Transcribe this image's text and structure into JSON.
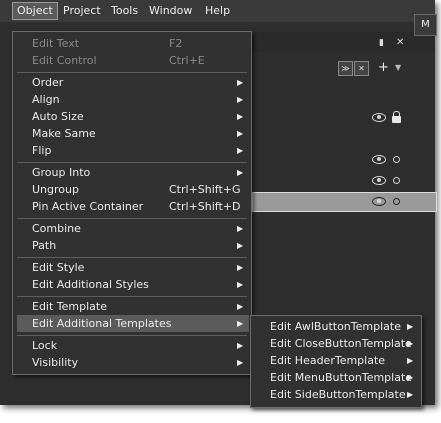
{
  "menubar": {
    "items": [
      {
        "label": "Object",
        "active": true
      },
      {
        "label": "Project"
      },
      {
        "label": "Tools"
      },
      {
        "label": "Window"
      },
      {
        "label": "Help"
      }
    ]
  },
  "object_menu": {
    "items": [
      {
        "label": "Edit Text",
        "shortcut": "F2",
        "disabled": true
      },
      {
        "label": "Edit Control",
        "shortcut": "Ctrl+E",
        "disabled": true
      },
      {
        "label": "Order"
      },
      {
        "label": "Align"
      },
      {
        "label": "Auto Size"
      },
      {
        "label": "Make Same"
      },
      {
        "label": "Flip"
      },
      {
        "label": "Group Into"
      },
      {
        "label": "Ungroup",
        "shortcut": "Ctrl+Shift+G"
      },
      {
        "label": "Pin Active Container",
        "shortcut": "Ctrl+Shift+D"
      },
      {
        "label": "Combine"
      },
      {
        "label": "Path"
      },
      {
        "label": "Edit Style"
      },
      {
        "label": "Edit Additional Styles"
      },
      {
        "label": "Edit Template"
      },
      {
        "label": "Edit Additional Templates",
        "highlighted": true
      },
      {
        "label": "Lock"
      },
      {
        "label": "Visibility"
      }
    ]
  },
  "templates_submenu": {
    "items": [
      {
        "label": "Edit AwlButtonTemplate"
      },
      {
        "label": "Edit CloseButtonTemplate"
      },
      {
        "label": "Edit HeaderTemplate"
      },
      {
        "label": "Edit MenuButtonTemplate"
      },
      {
        "label": "Edit SideButtonTemplate"
      }
    ]
  },
  "panel": {
    "corner_tab_label": "M",
    "add_button_label": "+"
  },
  "colors": {
    "app_background": "#2e2e2e",
    "menu_background": "#313131",
    "menu_highlight": "#5b5b5b",
    "disabled_text": "#8a8a8a",
    "selected_row": "#9a9a9a"
  },
  "icons": {
    "submenu_arrow": "▶",
    "visibility": "eye-icon",
    "lock": "lock-icon",
    "close": "close-icon",
    "pin": "pin-icon"
  }
}
